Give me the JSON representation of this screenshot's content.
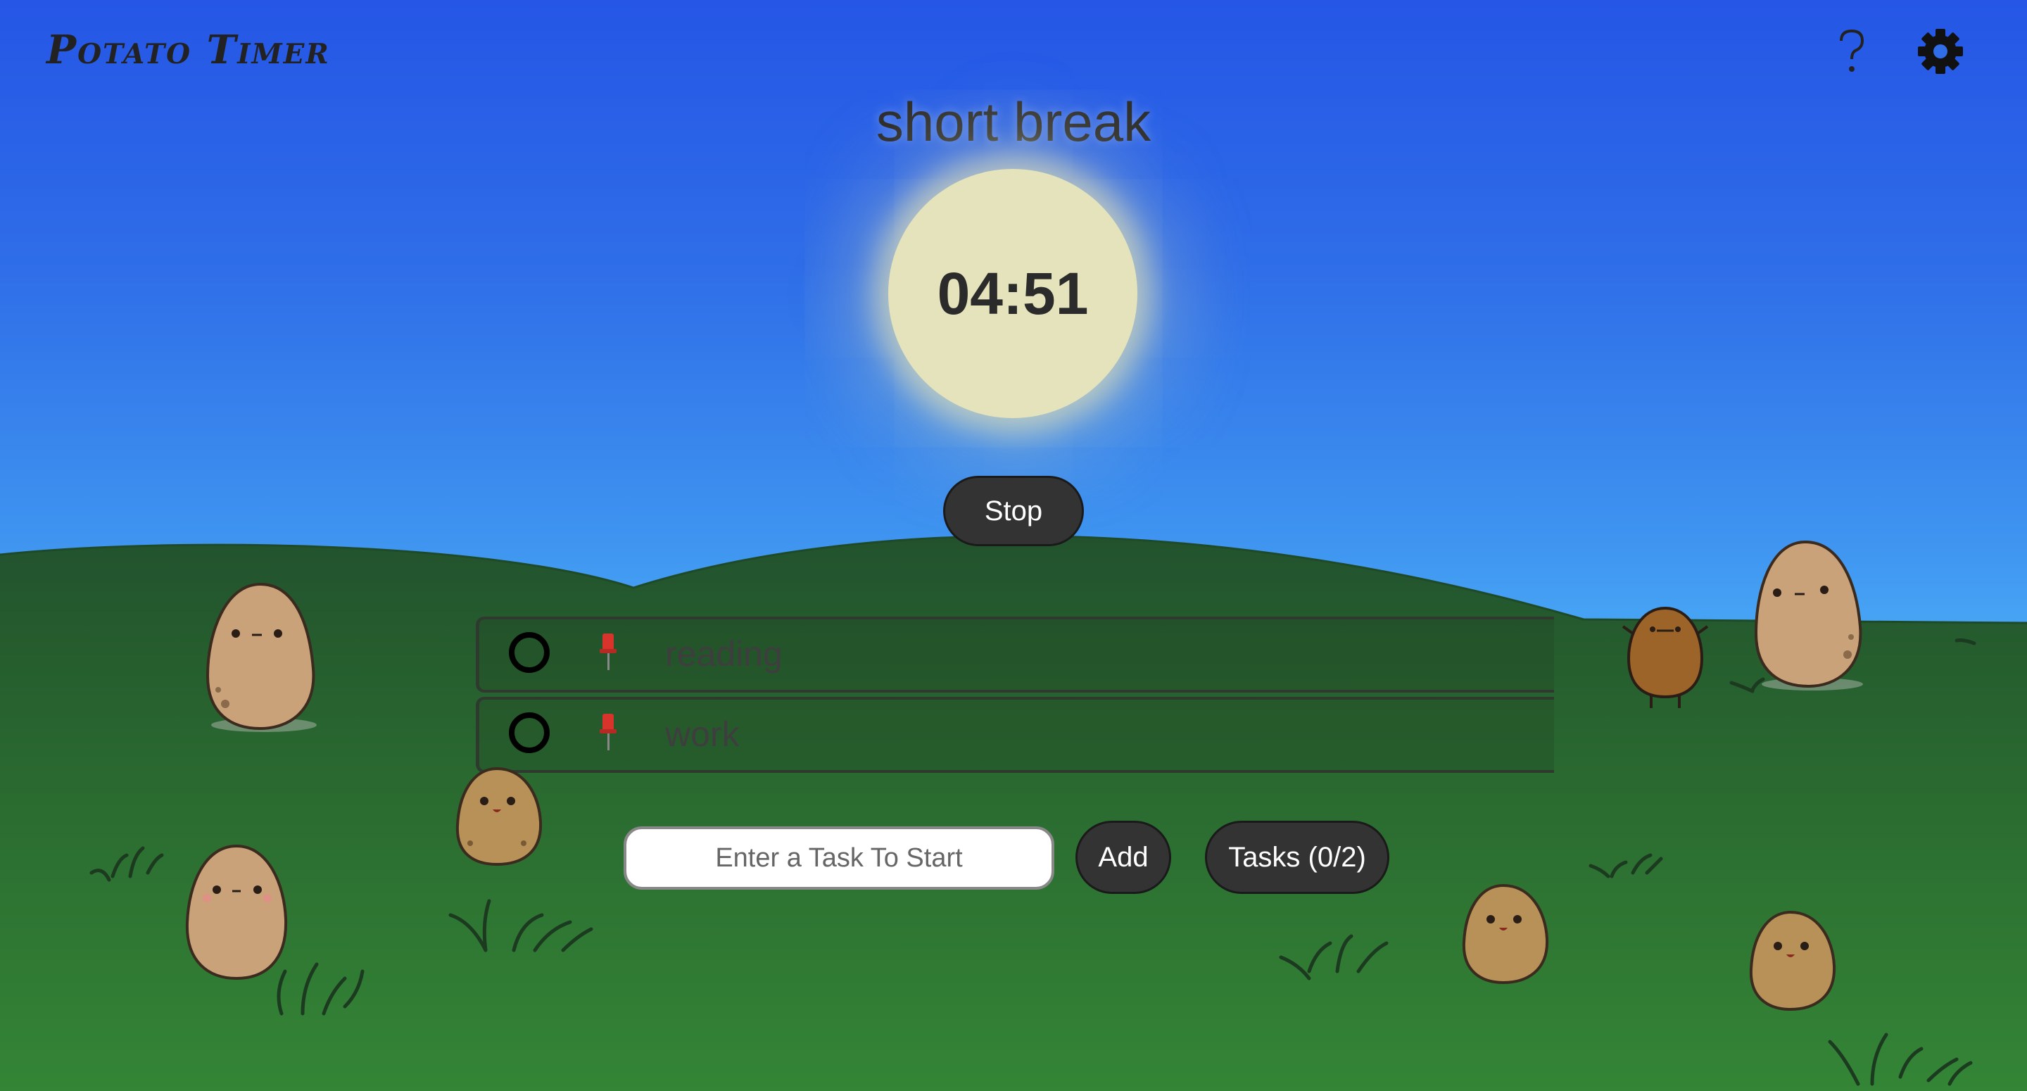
{
  "app": {
    "title": "Potato Timer"
  },
  "header": {
    "help_label": "?",
    "help_icon": "question-mark-icon",
    "settings_icon": "gear-icon"
  },
  "timer": {
    "mode": "short break",
    "time": "04:51"
  },
  "controls": {
    "stop_label": "Stop",
    "add_label": "Add",
    "tasks_label": "Tasks (0/2)"
  },
  "task_input": {
    "placeholder": "Enter a Task To Start",
    "value": ""
  },
  "tasks": [
    {
      "label": "reading",
      "done": false,
      "pinned": true
    },
    {
      "label": "work",
      "done": false,
      "pinned": true
    }
  ],
  "colors": {
    "sky_top": "#2556e6",
    "sky_horizon": "#48a6f5",
    "hill_dark": "#22522d",
    "grass": "#347f33",
    "sun": "#e5e3bc",
    "button_bg": "#333333",
    "pin": "#d9342b"
  }
}
